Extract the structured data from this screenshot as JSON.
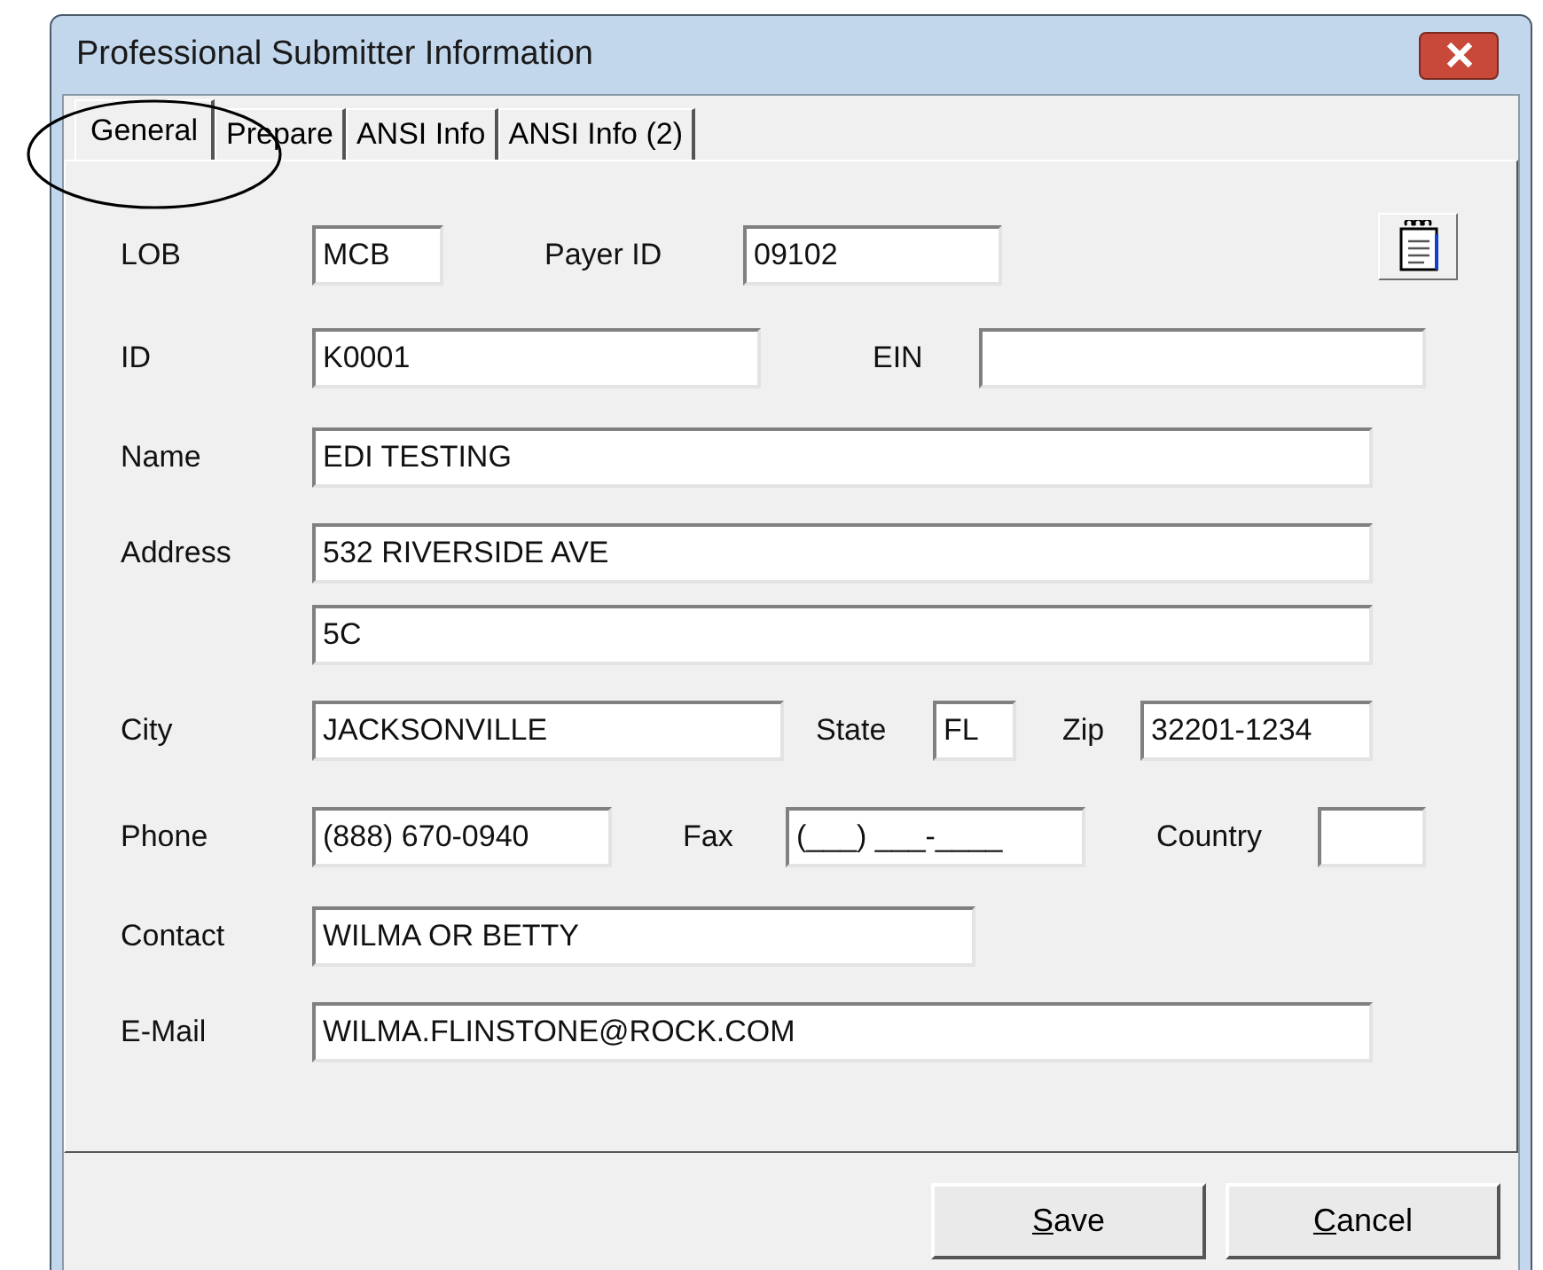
{
  "window": {
    "title": "Professional Submitter Information"
  },
  "tabs": [
    {
      "label": "General",
      "selected": true
    },
    {
      "label": "Prepare",
      "selected": false
    },
    {
      "label": "ANSI Info",
      "selected": false
    },
    {
      "label": "ANSI Info (2)",
      "selected": false
    }
  ],
  "rows": [
    {
      "items": [
        {
          "kind": "label",
          "text": "LOB"
        },
        {
          "kind": "field",
          "value": "MCB"
        },
        {
          "kind": "label",
          "text": "Payer ID"
        },
        {
          "kind": "field",
          "value": "09102"
        },
        {
          "kind": "icon_button"
        }
      ]
    },
    {
      "items": [
        {
          "kind": "label",
          "text": "ID"
        },
        {
          "kind": "field",
          "value": "K0001"
        },
        {
          "kind": "label",
          "text": "EIN"
        },
        {
          "kind": "field",
          "value": ""
        }
      ]
    },
    {
      "items": [
        {
          "kind": "label",
          "text": "Name"
        },
        {
          "kind": "field",
          "value": "EDI TESTING"
        }
      ]
    },
    {
      "items": [
        {
          "kind": "label",
          "text": "Address"
        },
        {
          "kind": "field",
          "value": "532 RIVERSIDE AVE"
        }
      ]
    },
    {
      "items": [
        {
          "kind": "spacer"
        },
        {
          "kind": "field",
          "value": "5C"
        }
      ]
    },
    {
      "items": [
        {
          "kind": "label",
          "text": "City"
        },
        {
          "kind": "field",
          "value": "JACKSONVILLE"
        },
        {
          "kind": "label",
          "text": "State"
        },
        {
          "kind": "field",
          "value": "FL"
        },
        {
          "kind": "label",
          "text": "Zip"
        },
        {
          "kind": "field",
          "value": "32201-1234"
        }
      ]
    },
    {
      "items": [
        {
          "kind": "label",
          "text": "Phone"
        },
        {
          "kind": "field",
          "value": "(888) 670-0940"
        },
        {
          "kind": "label",
          "text": "Fax"
        },
        {
          "kind": "field",
          "value": "(___) ___-____"
        },
        {
          "kind": "label",
          "text": "Country"
        },
        {
          "kind": "field",
          "value": ""
        }
      ]
    },
    {
      "items": [
        {
          "kind": "label",
          "text": "Contact"
        },
        {
          "kind": "field",
          "value": "WILMA OR BETTY"
        }
      ]
    },
    {
      "items": [
        {
          "kind": "label",
          "text": "E-Mail"
        },
        {
          "kind": "field",
          "value": "WILMA.FLINSTONE@ROCK.COM"
        }
      ]
    }
  ],
  "buttons": [
    {
      "label": "Save"
    },
    {
      "label": "Cancel"
    }
  ]
}
